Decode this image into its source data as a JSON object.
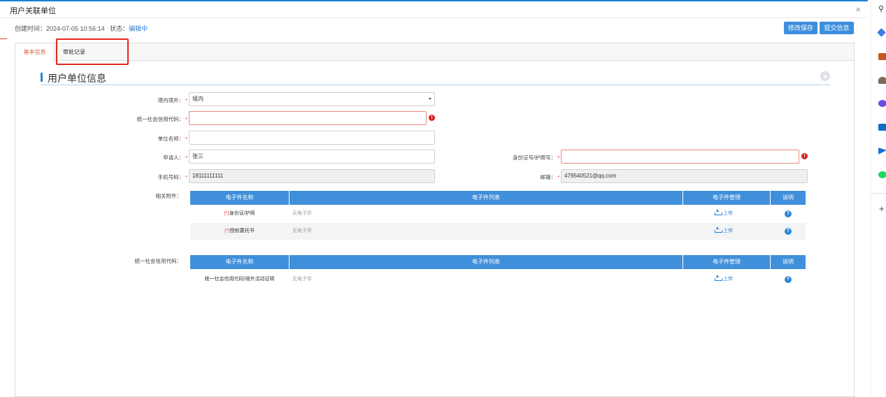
{
  "modal": {
    "title": "用户关联单位",
    "close": "×"
  },
  "info": {
    "created_label": "创建时间：",
    "created_value": "2024-07-05 10:56:14",
    "status_label": "状态：",
    "status_value": "编辑中"
  },
  "toolbar": {
    "save_label": "修改保存",
    "submit_label": "提交信息"
  },
  "tabs": [
    {
      "label": "基本信息",
      "active": true
    },
    {
      "label": "审批记录",
      "active": false
    }
  ],
  "section": {
    "title": "用户单位信息"
  },
  "form": {
    "domestic": {
      "label": "境内境外：",
      "value": "境内"
    },
    "credit_code": {
      "label": "统一社会信用代码：",
      "value": ""
    },
    "unit_name": {
      "label": "单位名称：",
      "value": ""
    },
    "applicant": {
      "label": "申请人：",
      "value": "张三"
    },
    "id_number": {
      "label": "身份证号/护照号：",
      "value": ""
    },
    "phone": {
      "label": "手机号码：",
      "value": "18111111111"
    },
    "email": {
      "label": "邮箱：",
      "value": "479540521@qq.com"
    },
    "required_mark": "*",
    "error_mark": "!"
  },
  "attachments": {
    "label": "相关附件：",
    "headers": [
      "电子件名称",
      "电子件列表",
      "电子件管理",
      "说明"
    ],
    "rows": [
      {
        "req": "(*)",
        "name": "身份证/护照",
        "list": "无电子件",
        "action": "上传",
        "help": "?"
      },
      {
        "req": "(*)",
        "name": "授权委托书",
        "list": "无电子件",
        "action": "上传",
        "help": "?"
      }
    ]
  },
  "credit_attachments": {
    "label": "统一社会信用代码：",
    "headers": [
      "电子件名称",
      "电子件列表",
      "电子件管理",
      "说明"
    ],
    "rows": [
      {
        "name": "统一社会信用代码/境外活动证明",
        "list": "无电子件",
        "action": "上传",
        "help": "?"
      }
    ]
  },
  "sidebar_icons": [
    "search-icon",
    "tag-icon",
    "briefcase-icon",
    "person-icon",
    "copilot-icon",
    "outlook-icon",
    "send-icon",
    "spotify-icon",
    "plus-icon"
  ],
  "colors": {
    "accent": "#3f8fdb",
    "tab_active": "#e4633a",
    "error": "#d8261c",
    "highlight": "#e8261c"
  }
}
